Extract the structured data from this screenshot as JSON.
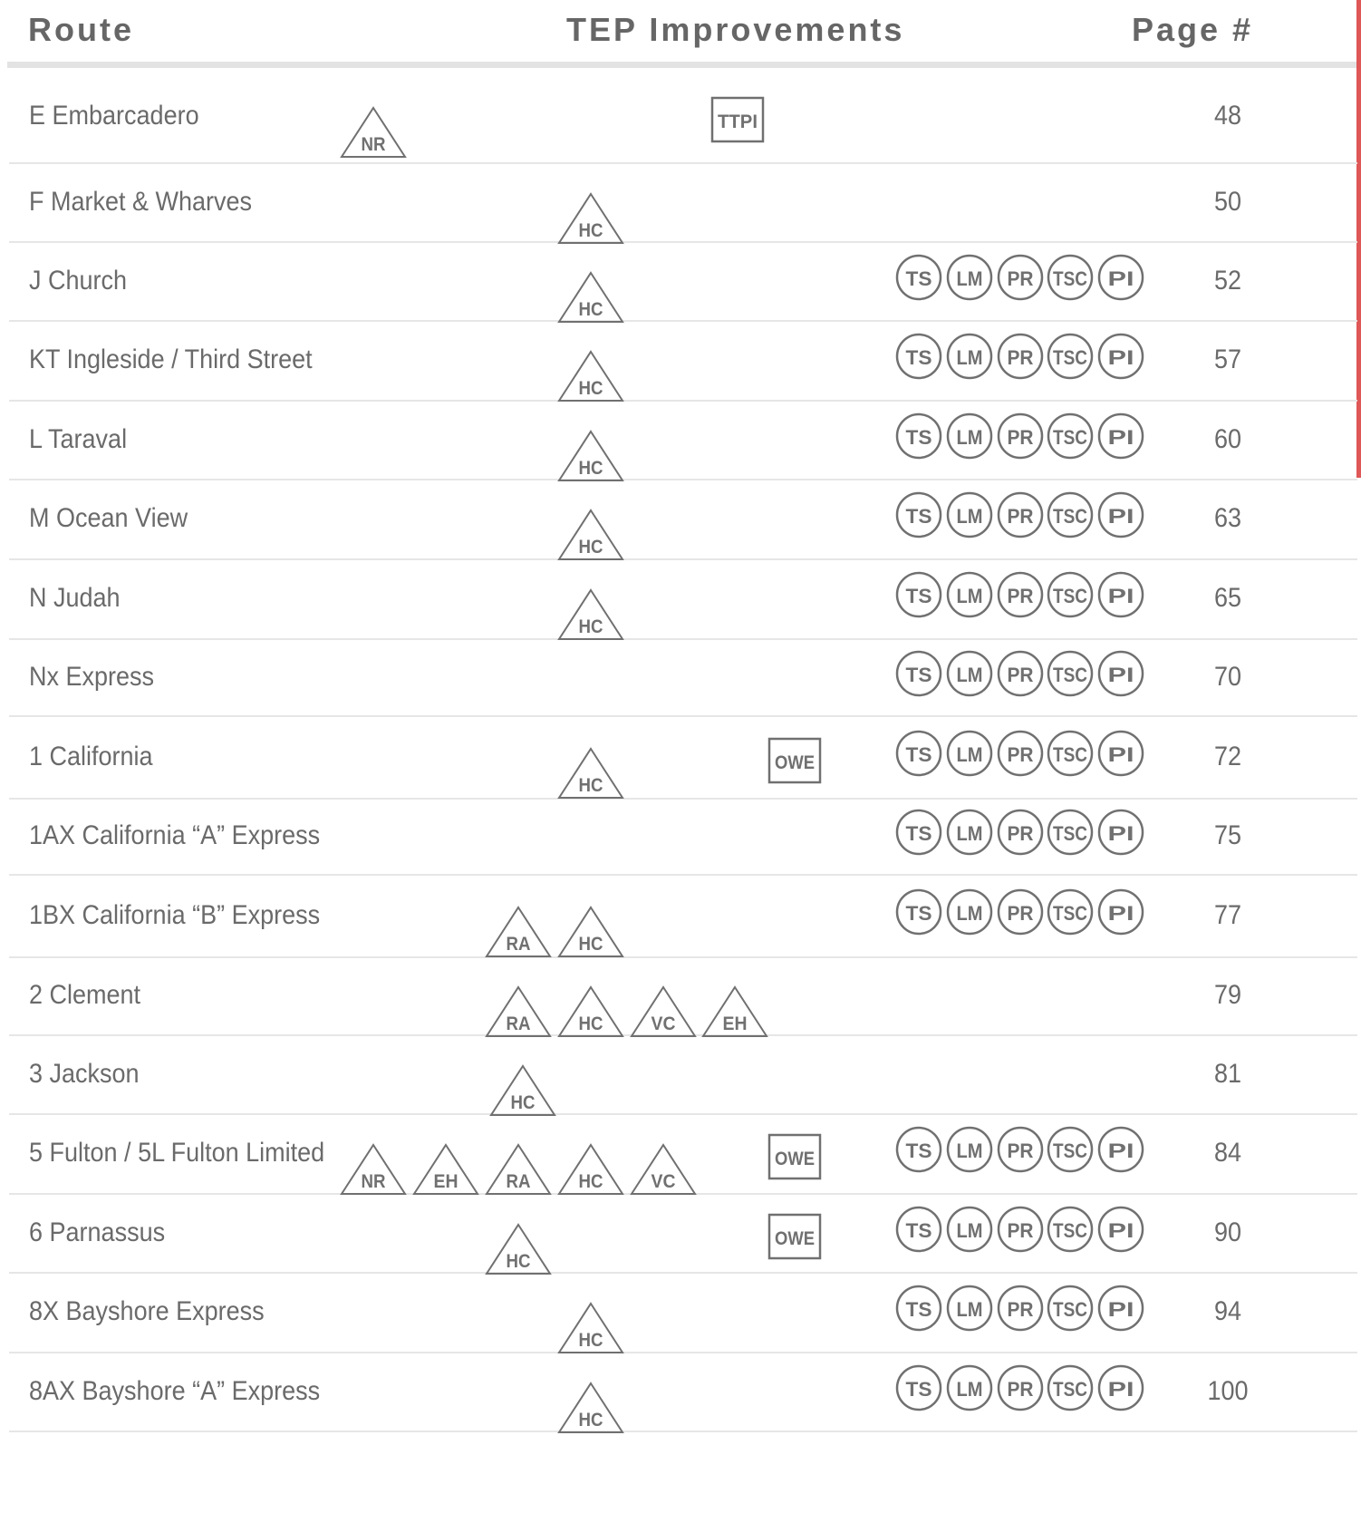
{
  "header": {
    "route": "Route",
    "improvements": "TEP Improvements",
    "page": "Page #"
  },
  "colors": {
    "icon_stroke": "#707070",
    "text": "#6a6a6a",
    "row_divider": "#e6e6e6",
    "header_rule": "#e3e3e3",
    "scroll_indicator": "#e05757"
  },
  "icon_types": {
    "triangle": [
      "NR",
      "HC",
      "RA",
      "VC",
      "EH"
    ],
    "box": [
      "TTPI",
      "OWE"
    ],
    "circle": [
      "TS",
      "LM",
      "PR",
      "TSC",
      "PI"
    ]
  },
  "routes": [
    {
      "name": "E Embarcadero",
      "page": "48",
      "icons": [
        "NR",
        "TTPI"
      ]
    },
    {
      "name": "F Market & Wharves",
      "page": "50",
      "icons": [
        "HC"
      ]
    },
    {
      "name": "J Church",
      "page": "52",
      "icons": [
        "HC",
        "TS",
        "LM",
        "PR",
        "TSC",
        "PI"
      ]
    },
    {
      "name": "KT Ingleside / Third Street",
      "page": "57",
      "icons": [
        "HC",
        "TS",
        "LM",
        "PR",
        "TSC",
        "PI"
      ]
    },
    {
      "name": "L Taraval",
      "page": "60",
      "icons": [
        "HC",
        "TS",
        "LM",
        "PR",
        "TSC",
        "PI"
      ]
    },
    {
      "name": "M Ocean View",
      "page": "63",
      "icons": [
        "HC",
        "TS",
        "LM",
        "PR",
        "TSC",
        "PI"
      ]
    },
    {
      "name": "N Judah",
      "page": "65",
      "icons": [
        "HC",
        "TS",
        "LM",
        "PR",
        "TSC",
        "PI"
      ]
    },
    {
      "name": "Nx Express",
      "page": "70",
      "icons": [
        "TS",
        "LM",
        "PR",
        "TSC",
        "PI"
      ]
    },
    {
      "name": "1 California",
      "page": "72",
      "icons": [
        "HC",
        "OWE",
        "TS",
        "LM",
        "PR",
        "TSC",
        "PI"
      ]
    },
    {
      "name": "1AX California “A” Express",
      "page": "75",
      "icons": [
        "TS",
        "LM",
        "PR",
        "TSC",
        "PI"
      ]
    },
    {
      "name": "1BX California “B” Express",
      "page": "77",
      "icons": [
        "RA",
        "HC",
        "TS",
        "LM",
        "PR",
        "TSC",
        "PI"
      ]
    },
    {
      "name": "2 Clement",
      "page": "79",
      "icons": [
        "RA",
        "HC",
        "VC",
        "EH"
      ]
    },
    {
      "name": "3 Jackson",
      "page": "81",
      "icons": [
        "HC"
      ]
    },
    {
      "name": "5 Fulton / 5L Fulton Limited",
      "page": "84",
      "icons": [
        "NR",
        "EH",
        "RA",
        "HC",
        "VC",
        "OWE",
        "TS",
        "LM",
        "PR",
        "TSC",
        "PI"
      ]
    },
    {
      "name": "6 Parnassus",
      "page": "90",
      "icons": [
        "HC",
        "OWE",
        "TS",
        "LM",
        "PR",
        "TSC",
        "PI"
      ]
    },
    {
      "name": "8X Bayshore Express",
      "page": "94",
      "icons": [
        "HC",
        "TS",
        "LM",
        "PR",
        "TSC",
        "PI"
      ]
    },
    {
      "name": "8AX Bayshore “A” Express",
      "page": "100",
      "icons": [
        "HC",
        "TS",
        "LM",
        "PR",
        "TSC",
        "PI"
      ]
    }
  ]
}
